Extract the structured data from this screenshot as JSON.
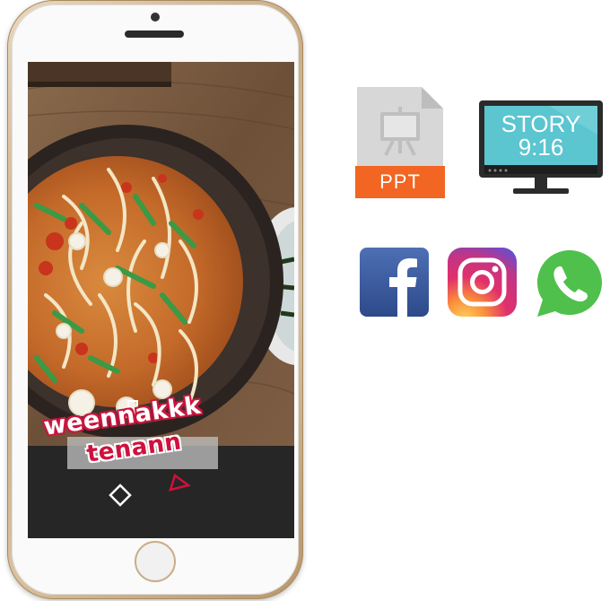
{
  "phone": {
    "caption_line_1": "weennakkk",
    "caption_line_2": "tenann"
  },
  "format_icons": {
    "ppt_label": "PPT",
    "monitor_line_1": "STORY",
    "monitor_line_2": "9:16"
  },
  "social_icons": [
    "facebook-icon",
    "instagram-icon",
    "whatsapp-icon"
  ],
  "colors": {
    "ppt_orange": "#f26522",
    "monitor_screen": "#5bc5d0",
    "facebook_blue": "#3b5998",
    "whatsapp_green": "#4fc04c",
    "caption_red": "#d0103d"
  }
}
